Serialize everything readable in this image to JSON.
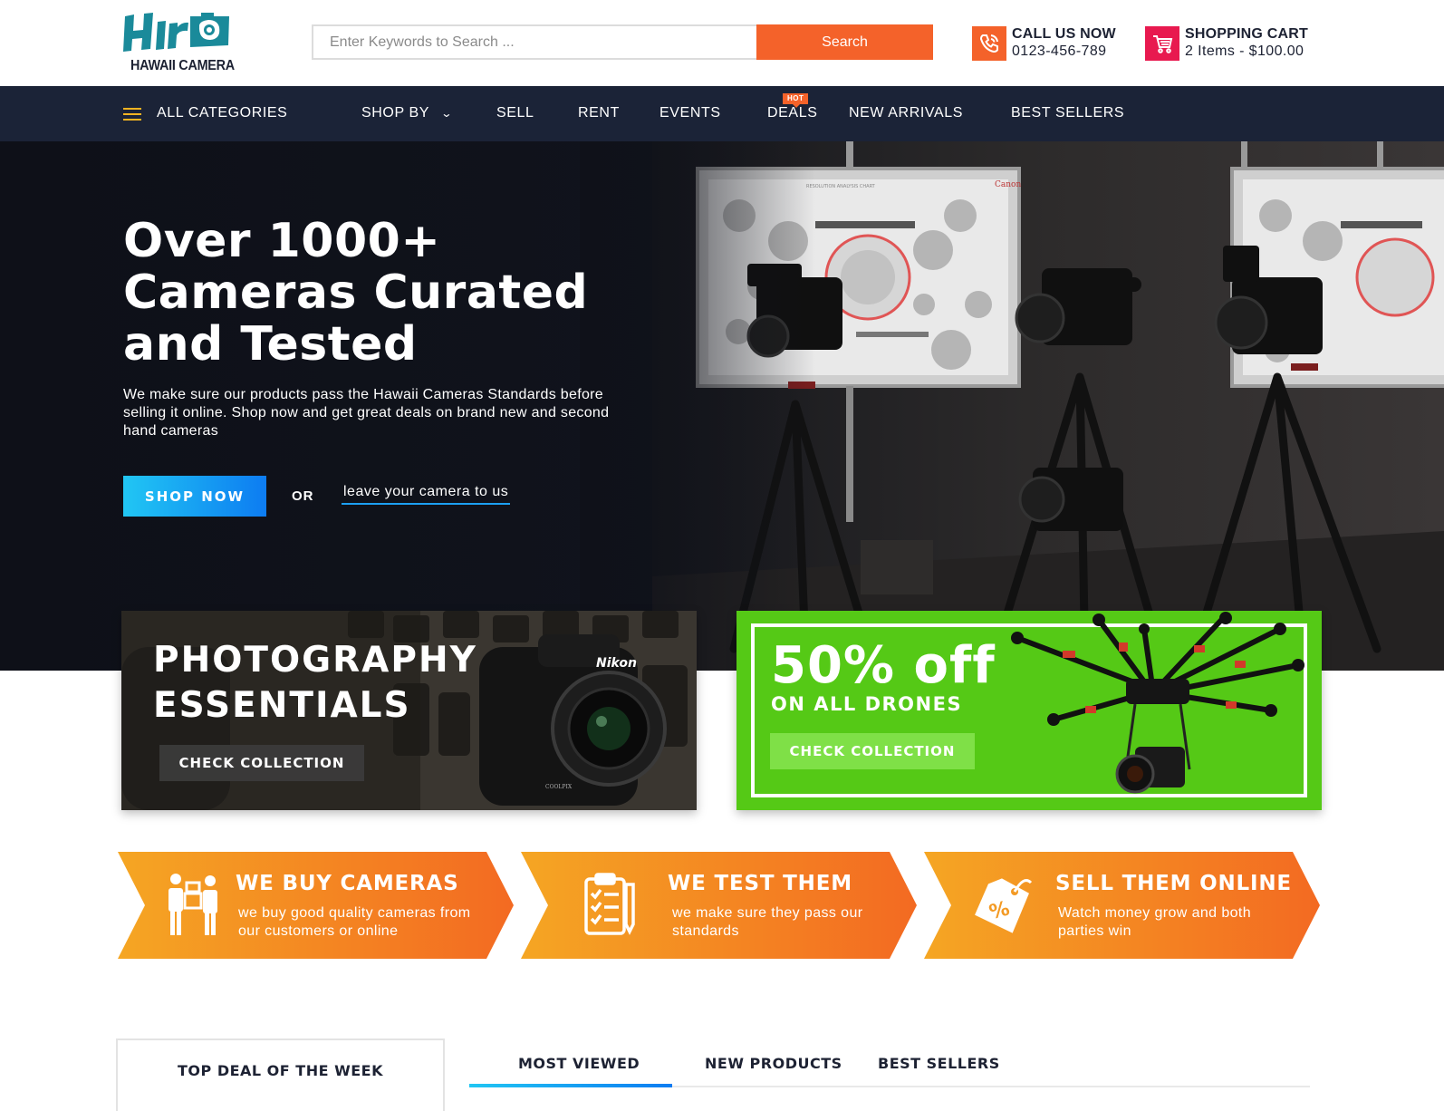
{
  "brand": {
    "logo_mark": "HIro",
    "name": "HAWAII CAMERA"
  },
  "search": {
    "placeholder": "Enter Keywords to Search ...",
    "button_label": "Search"
  },
  "call": {
    "label": "CALL US NOW",
    "phone": "0123-456-789",
    "icon": "phone-icon"
  },
  "cart": {
    "label": "SHOPPING CART",
    "summary": "2 Items - $100.00",
    "icon": "cart-icon"
  },
  "nav": {
    "all_categories": "ALL CATEGORIES",
    "items": [
      "SHOP BY",
      "SELL",
      "RENT",
      "EVENTS",
      "DEALS",
      "NEW ARRIVALS",
      "BEST SELLERS"
    ],
    "hot_badge": "HOT"
  },
  "hero": {
    "title": "Over 1000+ Cameras Curated and Tested",
    "subtitle": "We make sure our products pass the Hawaii Cameras Standards before selling it online. Shop now and get great deals on brand new and second hand cameras",
    "cta": "SHOP NOW",
    "or": "OR",
    "link": "leave your camera to us",
    "chart_brand": "Canon",
    "chart_label": "RESOLUTION ANALYSIS CHART"
  },
  "promos": {
    "photography": {
      "title_line1": "PHOTOGRAPHY",
      "title_line2": "ESSENTIALS",
      "button": "CHECK COLLECTION",
      "camera_brand": "Nikon",
      "camera_model": "COOLPIX"
    },
    "drones": {
      "headline": "50% off",
      "subline": "ON ALL DRONES",
      "button": "CHECK COLLECTION"
    }
  },
  "process": [
    {
      "title": "WE BUY CAMERAS",
      "desc": "we buy good quality cameras from our customers or online",
      "icon": "handshake-boxes-icon"
    },
    {
      "title": "WE TEST THEM",
      "desc": "we make sure they pass our standards",
      "icon": "clipboard-checklist-icon"
    },
    {
      "title": "SELL THEM ONLINE",
      "desc": "Watch money grow and both parties win",
      "icon": "price-tag-icon"
    }
  ],
  "deals": {
    "title": "TOP DEAL OF THE WEEK"
  },
  "tabs": {
    "items": [
      "MOST VIEWED",
      "NEW PRODUCTS",
      "BEST SELLERS"
    ],
    "active": "MOST VIEWED"
  },
  "colors": {
    "accent_orange": "#f4622a",
    "nav_bg": "#1b2337",
    "cart_red": "#e8194f",
    "cta_blue": "#0d7cf2",
    "drone_green": "#55c916",
    "logo_teal": "#1a8a9a"
  }
}
